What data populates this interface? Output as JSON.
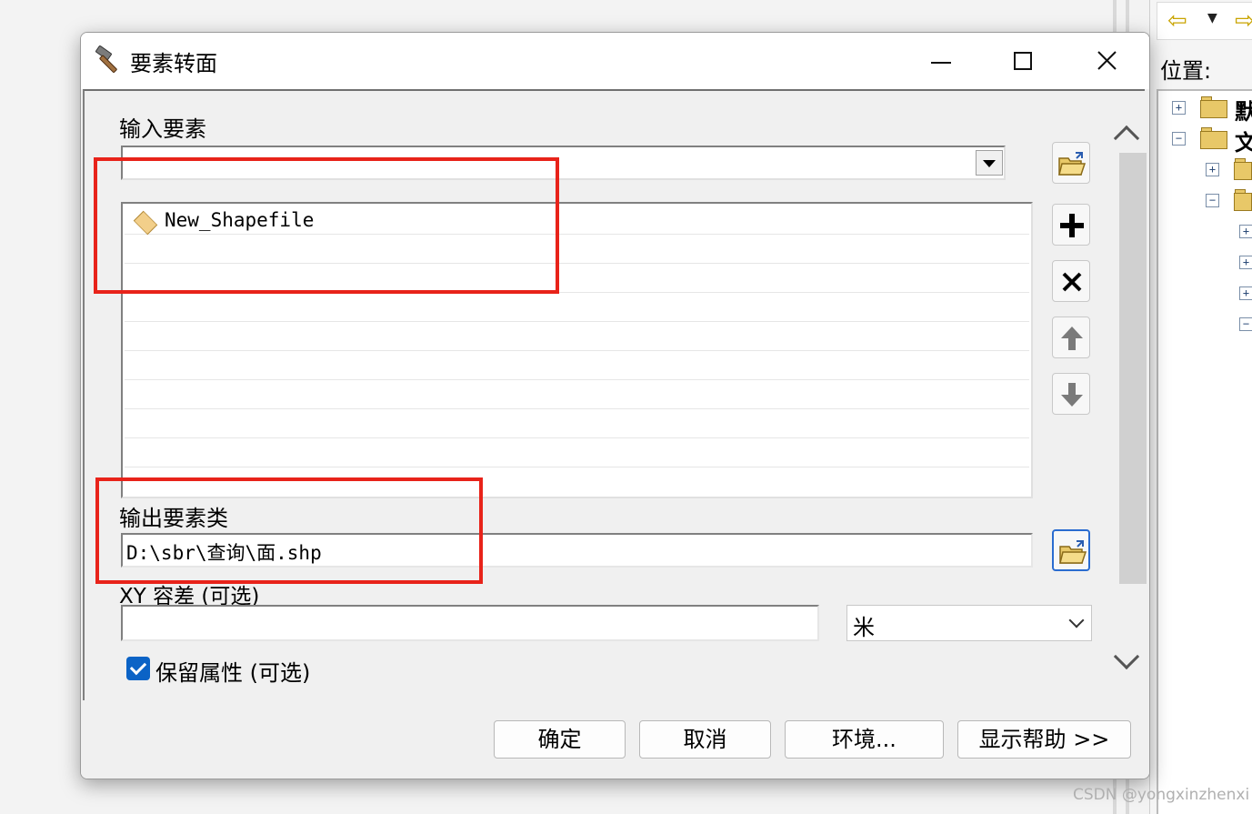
{
  "dialog": {
    "title": "要素转面",
    "input_features_label": "输入要素",
    "input_combo_value": "",
    "input_list": [
      "New_Shapefile"
    ],
    "output_label": "输出要素类",
    "output_value": "D:\\sbr\\查询\\面.shp",
    "xy_tolerance_label": "XY 容差 (可选)",
    "xy_tolerance_value": "",
    "unit_value": "米",
    "keep_attributes_label": "保留属性 (可选)",
    "keep_attributes_checked": true
  },
  "buttons": {
    "ok": "确定",
    "cancel": "取消",
    "environments": "环境...",
    "show_help": "显示帮助 >>"
  },
  "catalog": {
    "location_label": "位置:",
    "tree_top_labels": [
      "默",
      "文"
    ]
  },
  "watermark": "CSDN @yongxinzhenxi",
  "colors": {
    "highlight_box": "#e8231a",
    "checkbox": "#0b63c6"
  }
}
